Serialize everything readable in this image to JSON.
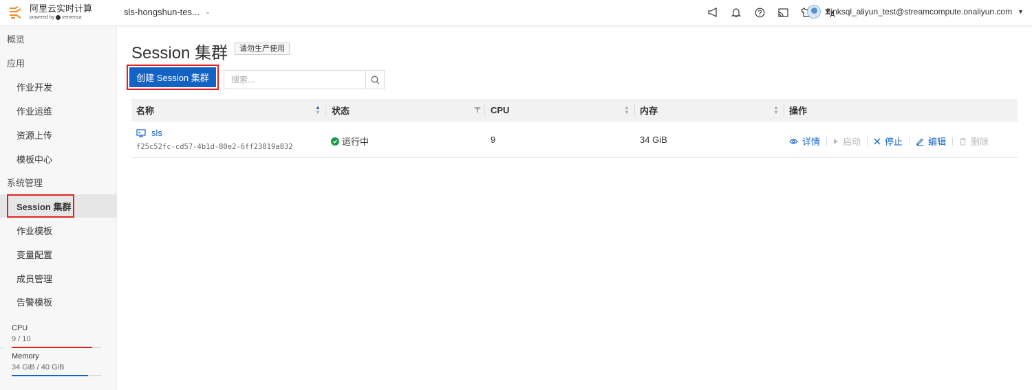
{
  "brand": {
    "title": "阿里云实时计算",
    "powered_by": "powered by",
    "partner": "ververica"
  },
  "workspace": {
    "name": "sls-hongshun-tes..."
  },
  "header_icons": [
    "announcement-icon",
    "bell-icon",
    "help-icon",
    "cast-icon",
    "shirt-icon",
    "translate-icon"
  ],
  "user": {
    "email": "flinksql_aliyun_test@streamcompute.onaliyun.com"
  },
  "sidebar": {
    "items": [
      {
        "label": "概览"
      },
      {
        "label": "应用"
      },
      {
        "label": "作业开发"
      },
      {
        "label": "作业运维"
      },
      {
        "label": "资源上传"
      },
      {
        "label": "模板中心"
      },
      {
        "label": "系统管理"
      },
      {
        "label": "Session 集群"
      },
      {
        "label": "作业模板"
      },
      {
        "label": "变量配置"
      },
      {
        "label": "成员管理"
      },
      {
        "label": "告警模板"
      }
    ],
    "usage": {
      "cpu": {
        "label": "CPU",
        "value": "9 / 10",
        "ratio": 0.9,
        "color": "#e02020"
      },
      "memory": {
        "label": "Memory",
        "value": "34 GiB / 40 GiB",
        "ratio": 0.85,
        "color": "#1463c4"
      }
    }
  },
  "main": {
    "title": "Session 集群",
    "tag": "请勿生产使用",
    "create_button": "创建 Session 集群",
    "search_placeholder": "搜索...",
    "table": {
      "columns": {
        "name": "名称",
        "status": "状态",
        "cpu": "CPU",
        "memory": "内存",
        "actions": "操作"
      },
      "rows": [
        {
          "name": "sls",
          "id": "f25c52fc-cd57-4b1d-80e2-6ff23819a832",
          "status": "运行中",
          "cpu": "9",
          "memory": "34 GiB",
          "actions": {
            "details": "详情",
            "start": "启动",
            "stop": "停止",
            "edit": "编辑",
            "delete": "删除"
          }
        }
      ]
    }
  },
  "colors": {
    "accent": "#1463c4",
    "highlight": "#e02020",
    "running": "#1a9a47"
  }
}
